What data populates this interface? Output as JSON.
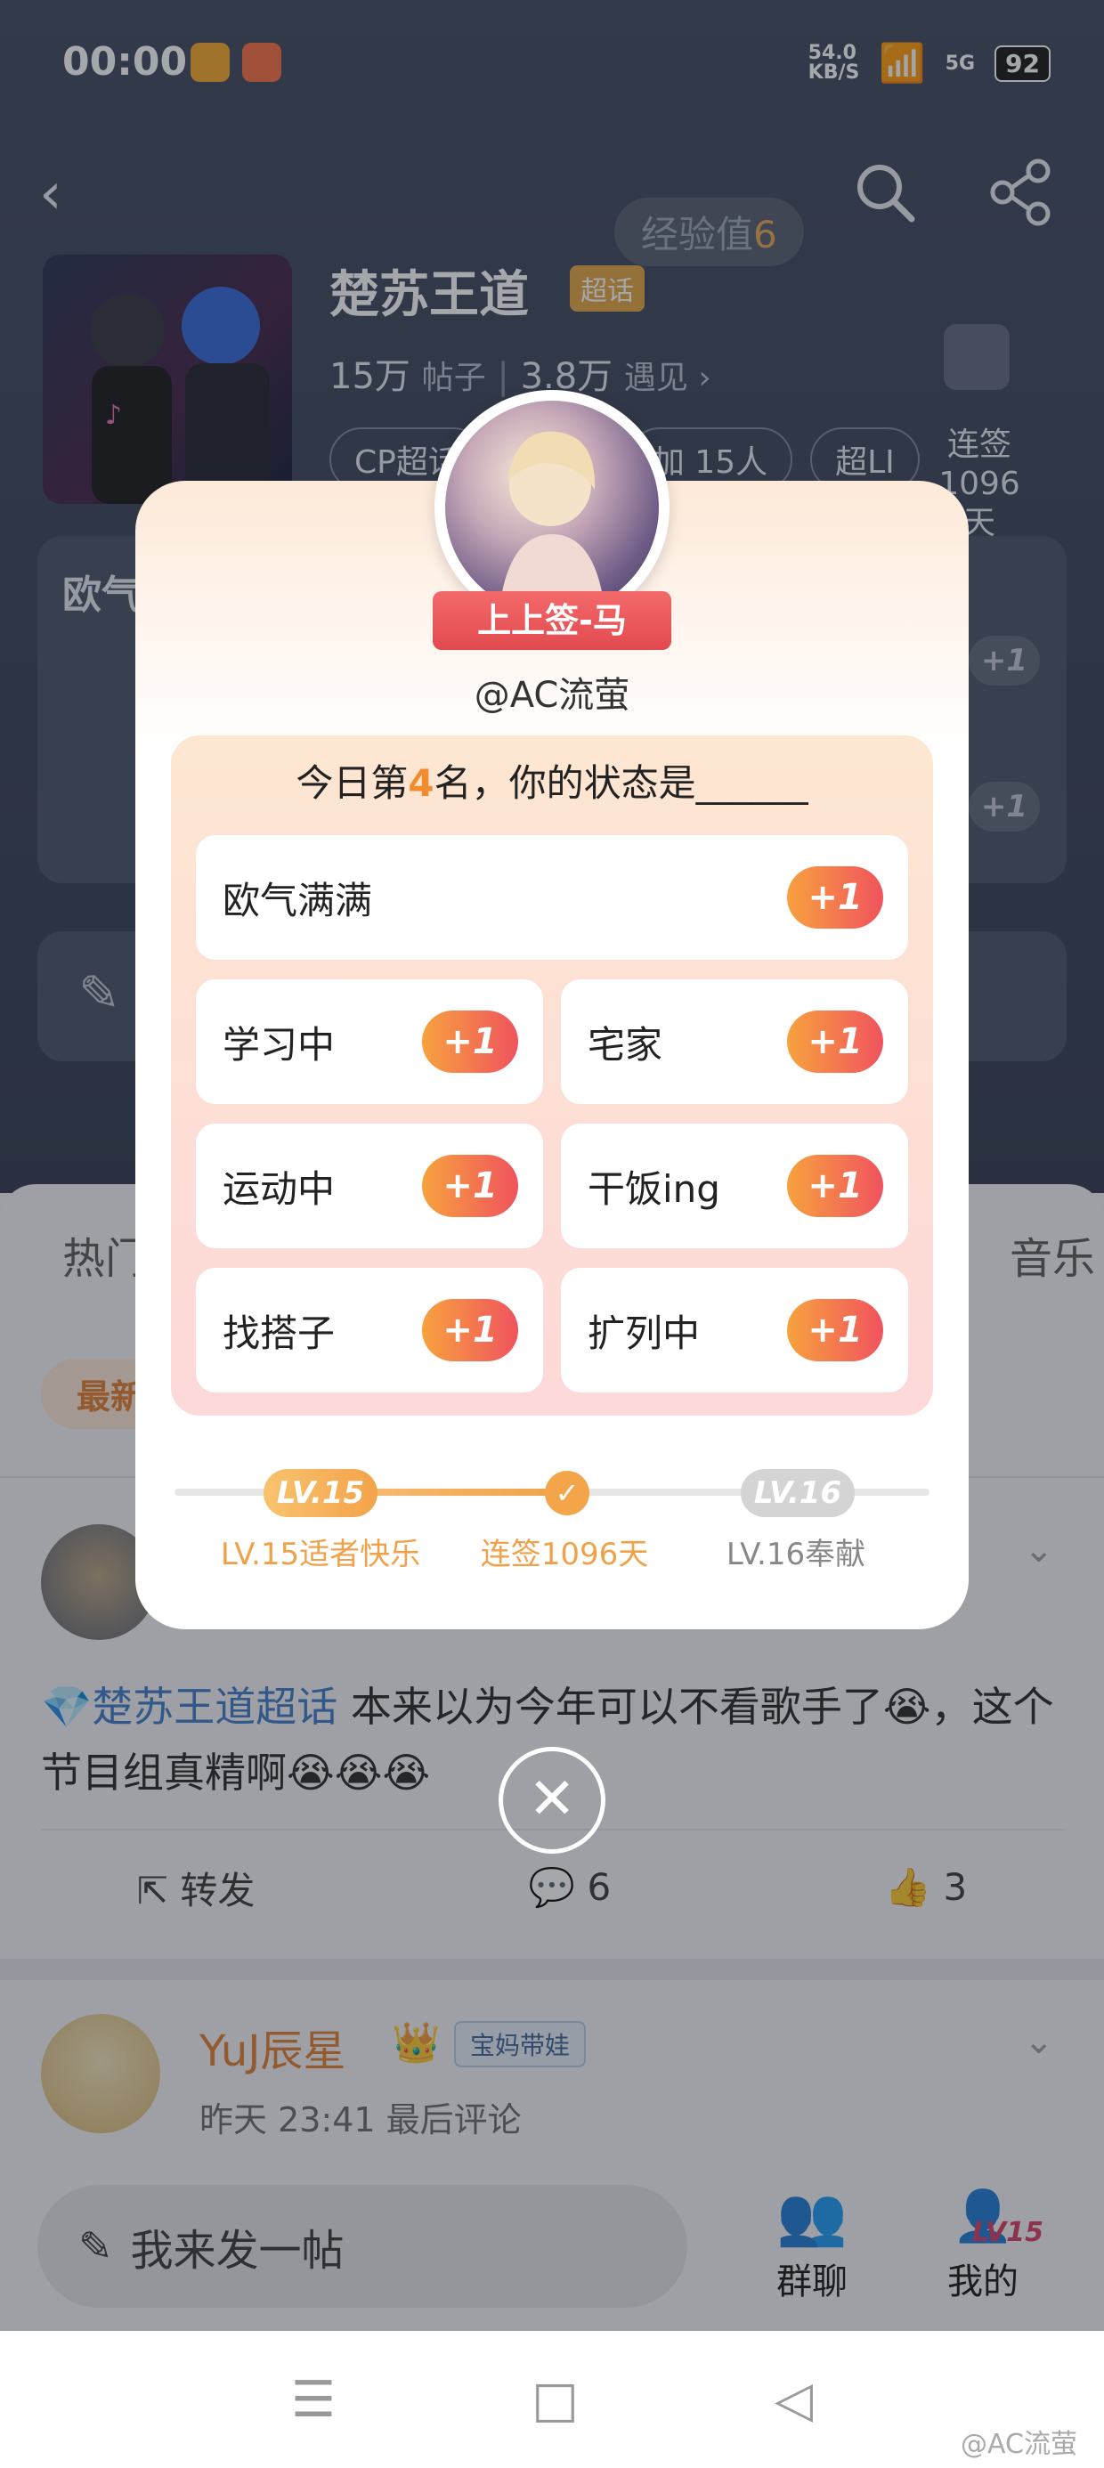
{
  "status_bar": {
    "time": "00:00",
    "net_speed": "54.0\nKB/S",
    "signal": "5G",
    "battery": "92"
  },
  "header": {
    "exp_label": "经验值",
    "exp_value": "6"
  },
  "topic": {
    "name": "楚苏王道",
    "tag": "超话",
    "posts_count": "15万",
    "posts_label": "帖子",
    "meet_count": "3.8万",
    "meet_label": "遇见 ›",
    "chips": [
      "CP超话",
      "加 15人",
      "超LI"
    ],
    "checkin_line1": "连签",
    "checkin_line2": "1096天"
  },
  "background_sections": {
    "card_title": "欧气",
    "tab_hot": "热门",
    "tab_music": "音乐",
    "tab_newest": "最新",
    "plus": "+1"
  },
  "popup": {
    "ribbon": "上上签-马",
    "handle": "@AC流萤",
    "question_prefix": "今日第",
    "question_rank": "4",
    "question_suffix": "名，你的状态是______",
    "options": [
      {
        "label": "欧气满满",
        "action": "+1"
      },
      {
        "label": "学习中",
        "action": "+1"
      },
      {
        "label": "宅家",
        "action": "+1"
      },
      {
        "label": "运动中",
        "action": "+1"
      },
      {
        "label": "干饭ing",
        "action": "+1"
      },
      {
        "label": "找搭子",
        "action": "+1"
      },
      {
        "label": "扩列中",
        "action": "+1"
      }
    ],
    "level_current_badge": "LV.15",
    "level_next_badge": "LV.16",
    "level_current_label": "LV.15适者快乐",
    "streak_label": "连签1096天",
    "level_next_label": "LV.16奉献",
    "progress_fraction": 0.5
  },
  "post": {
    "topic_link": "楚苏王道超话",
    "text": "本来以为今年可以不看歌手了😭，这个节目组真精啊😭😭😭",
    "repost_label": "转发",
    "comment_count": "6",
    "like_count": "3"
  },
  "post2": {
    "username": "YuJ辰星",
    "badge": "宝妈带娃",
    "time": "昨天 23:41 最后评论"
  },
  "bottom": {
    "compose_placeholder": "我来发一帖",
    "group_chat": "群聊",
    "mine": "我的",
    "lv_badge": "LV15"
  },
  "watermark": "@AC流萤"
}
